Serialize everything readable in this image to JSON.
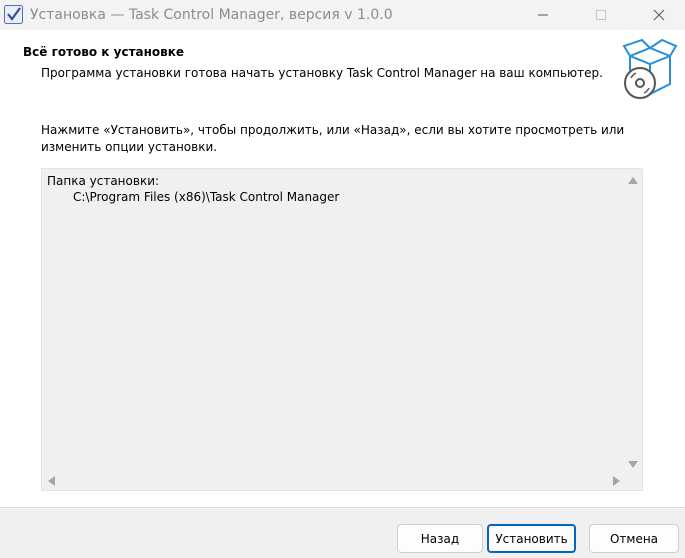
{
  "window": {
    "title": "Установка — Task Control Manager, версия v 1.0.0"
  },
  "header": {
    "title": "Всё готово к установке",
    "subtitle": "Программа установки готова начать установку Task Control Manager на ваш компьютер.",
    "icon": "setup-box-cd-icon"
  },
  "body": {
    "instruction": "Нажмите «Установить», чтобы продолжить, или «Назад», если вы хотите просмотреть или изменить опции установки."
  },
  "memo": {
    "label": "Папка установки:",
    "value": "C:\\Program Files (x86)\\Task Control Manager"
  },
  "buttons": {
    "back": "Назад",
    "install": "Установить",
    "cancel": "Отмена"
  },
  "colors": {
    "accent": "#0067c0",
    "footer_bg": "#f0f0f0",
    "icon_blue": "#2a8fd6"
  }
}
